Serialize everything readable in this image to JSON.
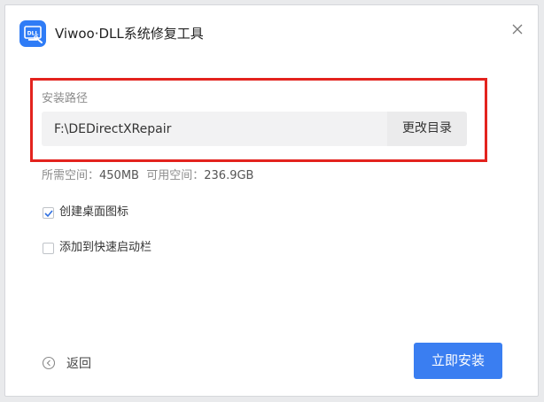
{
  "window": {
    "title": "Viwoo·DLL系统修复工具"
  },
  "install_path": {
    "label": "安装路径",
    "value": "F:\\DEDirectXRepair",
    "change_button": "更改目录"
  },
  "space": {
    "required_label": "所需空间：",
    "required_value": "450MB",
    "available_label": "可用空间：",
    "available_value": "236.9GB"
  },
  "options": [
    {
      "label": "创建桌面图标",
      "checked": true
    },
    {
      "label": "添加到快速启动栏",
      "checked": false
    }
  ],
  "footer": {
    "back_label": "返回",
    "install_label": "立即安装"
  },
  "colors": {
    "accent": "#3a7ef1",
    "highlight": "#e3231e",
    "app_icon": "#2f7cf6"
  }
}
